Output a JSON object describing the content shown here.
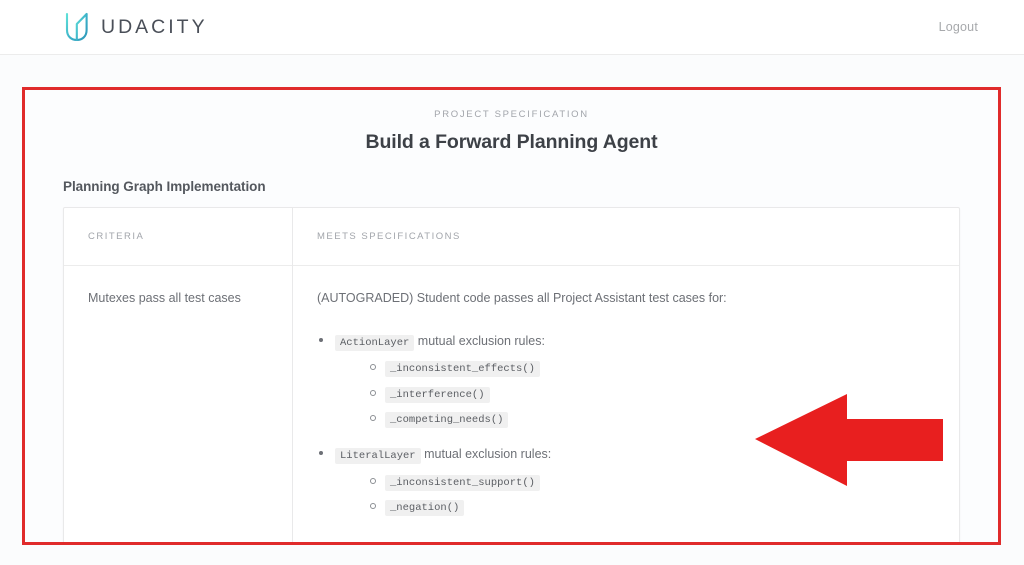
{
  "header": {
    "brand_name": "UDACITY",
    "brand_icon": "udacity-u-logo",
    "logout_label": "Logout"
  },
  "spec": {
    "kicker": "PROJECT SPECIFICATION",
    "title": "Build a Forward Planning Agent",
    "section_heading": "Planning Graph Implementation"
  },
  "table": {
    "headers": {
      "criteria": "CRITERIA",
      "meets_specifications": "MEETS SPECIFICATIONS"
    },
    "row": {
      "criteria": "Mutexes pass all test cases",
      "intro": "(AUTOGRADED) Student code passes all Project Assistant test cases for:",
      "groups": [
        {
          "code": "ActionLayer",
          "text": "mutual exclusion rules:",
          "items": [
            "_inconsistent_effects()",
            "_interference()",
            "_competing_needs()"
          ]
        },
        {
          "code": "LiteralLayer",
          "text": "mutual exclusion rules:",
          "items": [
            "_inconsistent_support()",
            "_negation()"
          ]
        }
      ]
    }
  },
  "annotation": {
    "arrow_icon": "left-arrow-annotation",
    "arrow_color": "#e81f1f",
    "frame_color": "#e02b2b"
  }
}
